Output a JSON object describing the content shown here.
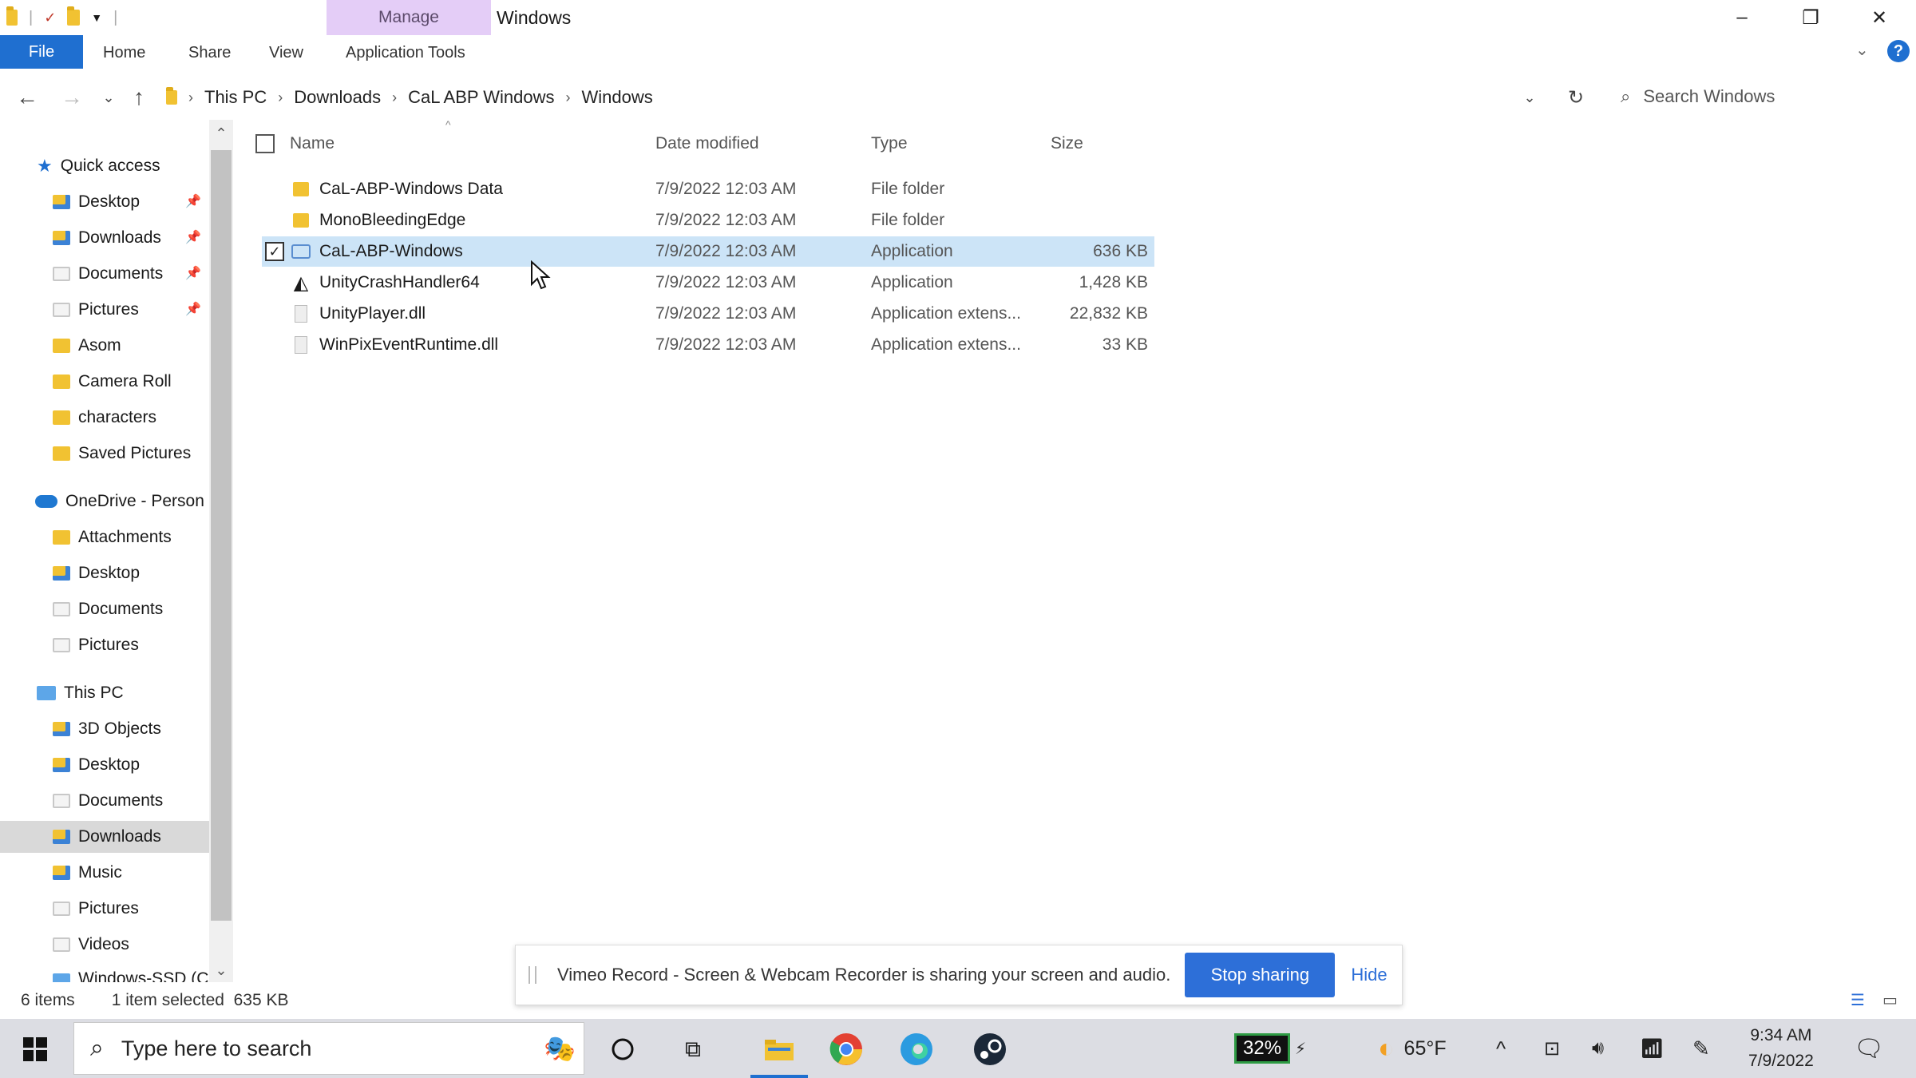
{
  "window": {
    "manage_tab": "Manage",
    "title": "Windows"
  },
  "ribbon": {
    "file": "File",
    "tabs": [
      "Home",
      "Share",
      "View",
      "Application Tools"
    ]
  },
  "address": {
    "crumbs": [
      "This PC",
      "Downloads",
      "CaL ABP Windows",
      "Windows"
    ],
    "search_placeholder": "Search Windows"
  },
  "nav": {
    "quick_access": "Quick access",
    "quick_items": [
      "Desktop",
      "Downloads",
      "Documents",
      "Pictures",
      "Asom",
      "Camera Roll",
      "characters",
      "Saved Pictures"
    ],
    "onedrive": "OneDrive - Person",
    "onedrive_items": [
      "Attachments",
      "Desktop",
      "Documents",
      "Pictures"
    ],
    "this_pc": "This PC",
    "pc_items": [
      "3D Objects",
      "Desktop",
      "Documents",
      "Downloads",
      "Music",
      "Pictures",
      "Videos",
      "Windows-SSD (C"
    ]
  },
  "columns": {
    "name": "Name",
    "date": "Date modified",
    "type": "Type",
    "size": "Size"
  },
  "files": [
    {
      "name": "CaL-ABP-Windows Data",
      "date": "7/9/2022 12:03 AM",
      "type": "File folder",
      "size": "",
      "icon": "folder-icon"
    },
    {
      "name": "MonoBleedingEdge",
      "date": "7/9/2022 12:03 AM",
      "type": "File folder",
      "size": "",
      "icon": "folder-icon"
    },
    {
      "name": "CaL-ABP-Windows",
      "date": "7/9/2022 12:03 AM",
      "type": "Application",
      "size": "636 KB",
      "icon": "application-icon",
      "selected": true
    },
    {
      "name": "UnityCrashHandler64",
      "date": "7/9/2022 12:03 AM",
      "type": "Application",
      "size": "1,428 KB",
      "icon": "unity-icon"
    },
    {
      "name": "UnityPlayer.dll",
      "date": "7/9/2022 12:03 AM",
      "type": "Application extens...",
      "size": "22,832 KB",
      "icon": "dll-icon"
    },
    {
      "name": "WinPixEventRuntime.dll",
      "date": "7/9/2022 12:03 AM",
      "type": "Application extens...",
      "size": "33 KB",
      "icon": "dll-icon"
    }
  ],
  "status": {
    "count": "6 items",
    "selection": "1 item selected  635 KB"
  },
  "banner": {
    "message": "Vimeo Record - Screen & Webcam Recorder is sharing your screen and audio.",
    "stop": "Stop sharing",
    "hide": "Hide"
  },
  "taskbar": {
    "search_placeholder": "Type here to search",
    "battery": "32%",
    "weather": "65°F",
    "time": "9:34 AM",
    "date": "7/9/2022"
  },
  "colors": {
    "accent": "#1f6fd0",
    "selection": "#cce4f7",
    "manage": "#e4cdf7"
  }
}
